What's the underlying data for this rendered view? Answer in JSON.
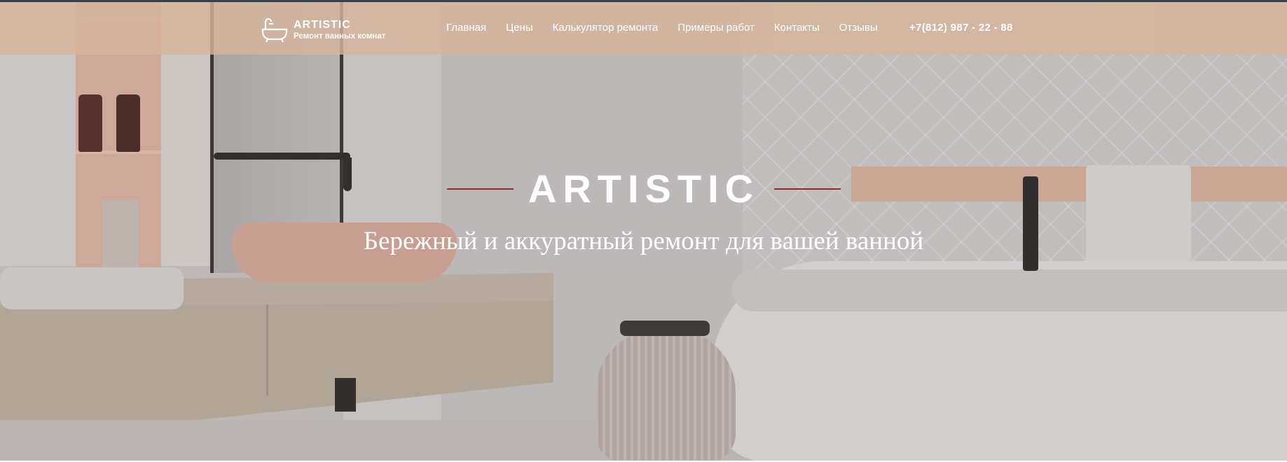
{
  "header": {
    "logo": {
      "icon": "bathtub-icon",
      "title": "ARTISTIC",
      "subtitle": "Ремонт ванных комнат"
    },
    "nav": [
      {
        "label": "Главная"
      },
      {
        "label": "Цены"
      },
      {
        "label": "Калькулятор ремонта"
      },
      {
        "label": "Примеры работ"
      },
      {
        "label": "Контакты"
      },
      {
        "label": "Отзывы"
      }
    ],
    "phone": "+7(812) 987 - 22 - 88"
  },
  "hero": {
    "title": "ARTISTIC",
    "subtitle": "Бережный и аккуратный ремонт для вашей ванной",
    "accent_line_color": "#8a2d26"
  },
  "colors": {
    "navbar_bg": "#d6b49b",
    "text": "#ffffff"
  }
}
